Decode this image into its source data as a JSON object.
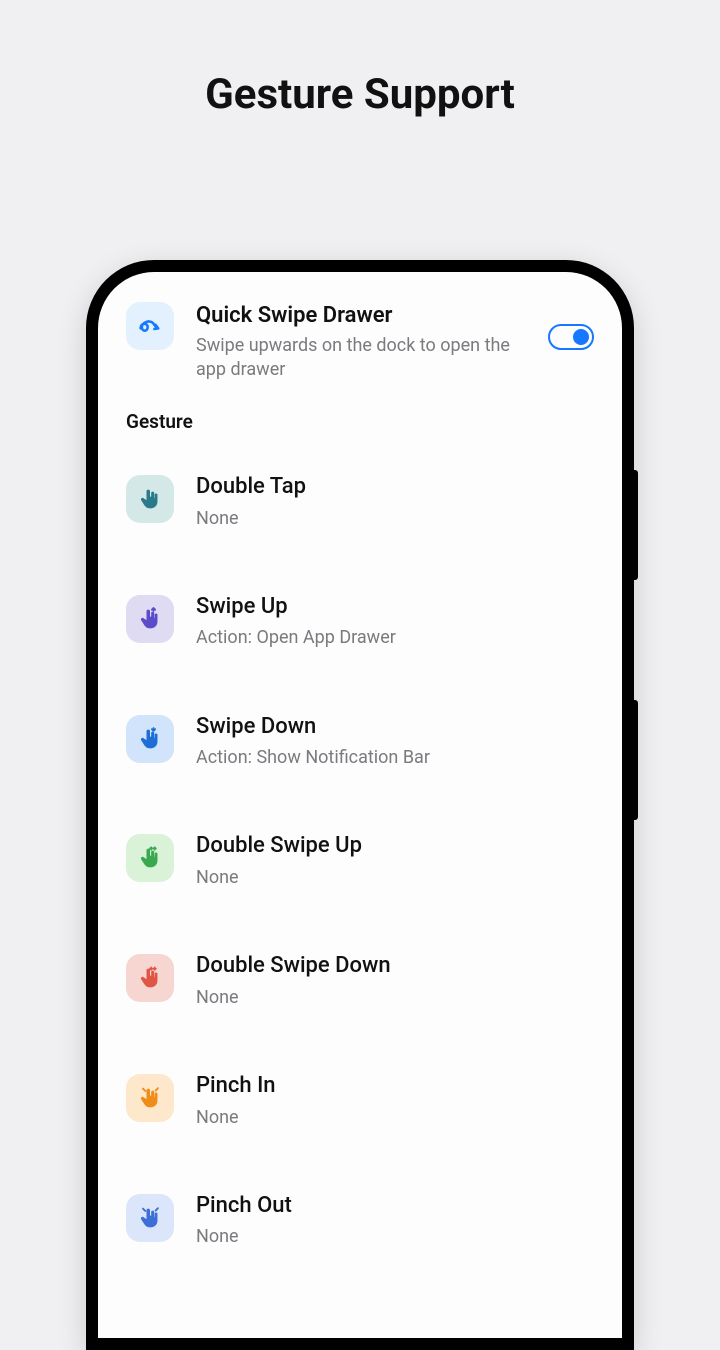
{
  "page_title": "Gesture Support",
  "quick": {
    "title": "Quick Swipe Drawer",
    "subtitle": "Swipe upwards on the dock to open the app drawer",
    "toggle_on": true,
    "icon": "squiggle-icon",
    "icon_bg": "#e2f1fd",
    "icon_fg": "#1677ff"
  },
  "section_label": "Gesture",
  "gestures": [
    {
      "title": "Double Tap",
      "sub": "None",
      "icon": "tap-icon",
      "bg": "#d4e9e7",
      "fg": "#2b7a8c"
    },
    {
      "title": "Swipe Up",
      "sub": "Action: Open App Drawer",
      "icon": "swipe-up-icon",
      "bg": "#dedbf3",
      "fg": "#5b4dc9"
    },
    {
      "title": "Swipe Down",
      "sub": "Action: Show Notification Bar",
      "icon": "swipe-down-icon",
      "bg": "#d1e4fb",
      "fg": "#1e6ed6"
    },
    {
      "title": "Double Swipe Up",
      "sub": "None",
      "icon": "two-up-icon",
      "bg": "#d9f2d8",
      "fg": "#3aa84f"
    },
    {
      "title": "Double Swipe Down",
      "sub": "None",
      "icon": "two-down-icon",
      "bg": "#f7d6d1",
      "fg": "#e05646"
    },
    {
      "title": "Pinch In",
      "sub": "None",
      "icon": "pinch-in-icon",
      "bg": "#fde8cc",
      "fg": "#f08c1a"
    },
    {
      "title": "Pinch Out",
      "sub": "None",
      "icon": "pinch-out-icon",
      "bg": "#dbe6fa",
      "fg": "#3d6fd6"
    }
  ]
}
